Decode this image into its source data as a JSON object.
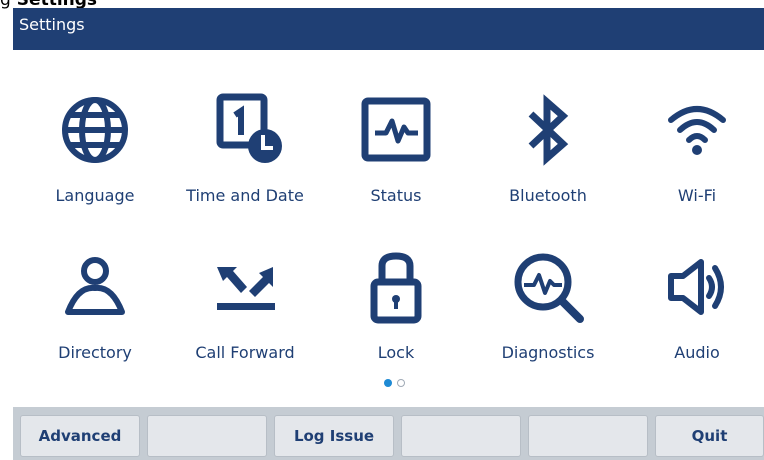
{
  "document": {
    "title_prefix": "g",
    "title": "Settings"
  },
  "header": {
    "title": "Settings"
  },
  "tiles": [
    {
      "label": "Language",
      "icon": "globe-icon"
    },
    {
      "label": "Time and Date",
      "icon": "calendar-clock-icon"
    },
    {
      "label": "Status",
      "icon": "status-monitor-icon"
    },
    {
      "label": "Bluetooth",
      "icon": "bluetooth-icon"
    },
    {
      "label": "Wi-Fi",
      "icon": "wifi-icon"
    },
    {
      "label": "Directory",
      "icon": "person-icon"
    },
    {
      "label": "Call Forward",
      "icon": "call-forward-icon"
    },
    {
      "label": "Lock",
      "icon": "lock-icon"
    },
    {
      "label": "Diagnostics",
      "icon": "diagnostics-icon"
    },
    {
      "label": "Audio",
      "icon": "speaker-icon"
    }
  ],
  "pagination": {
    "current_page": 1,
    "total_pages": 2
  },
  "softkeys": [
    {
      "label": "Advanced"
    },
    {
      "label": ""
    },
    {
      "label": "Log Issue"
    },
    {
      "label": ""
    },
    {
      "label": ""
    },
    {
      "label": "Quit"
    }
  ],
  "colors": {
    "primary": "#1f3f74",
    "header_bg": "#1f3f74",
    "page_dot_active": "#1e8ad4",
    "softkey_bar_bg": "#c5ccd3",
    "softkey_bg": "#e4e7eb"
  }
}
